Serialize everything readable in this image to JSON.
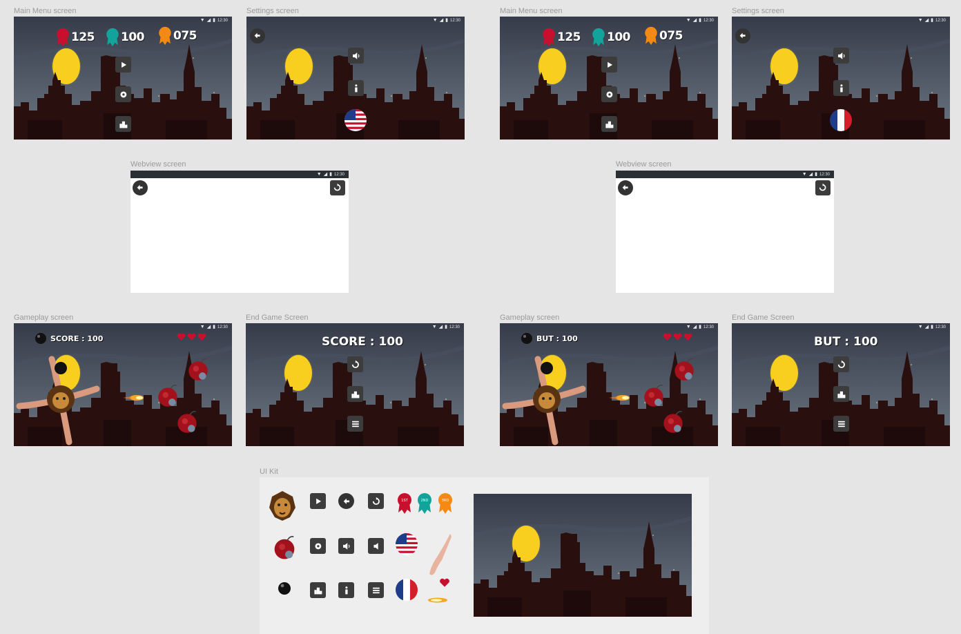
{
  "frames": {
    "main_menu_1": {
      "label": "Main Menu screen",
      "status_time": "12:30",
      "scores": {
        "first": "125",
        "second": "100",
        "third": "075"
      }
    },
    "settings_1": {
      "label": "Settings screen",
      "status_time": "12:30"
    },
    "main_menu_2": {
      "label": "Main Menu screen",
      "status_time": "12:30",
      "scores": {
        "first": "125",
        "second": "100",
        "third": "075"
      }
    },
    "settings_2": {
      "label": "Settings screen",
      "status_time": "12:30"
    },
    "webview_1": {
      "label": "Webview screen",
      "status_time": "12:30"
    },
    "webview_2": {
      "label": "Webview screen",
      "status_time": "12:30"
    },
    "gameplay_1": {
      "label": "Gameplay screen",
      "status_time": "12:30",
      "score_text": "SCORE : 100"
    },
    "endgame_1": {
      "label": "End Game Screen",
      "status_time": "12:30",
      "score_text": "SCORE : 100"
    },
    "gameplay_2": {
      "label": "Gameplay screen",
      "status_time": "12:30",
      "score_text": "BUT : 100"
    },
    "endgame_2": {
      "label": "End Game Screen",
      "status_time": "12:30",
      "score_text": "BUT : 100"
    },
    "ui_kit": {
      "label": "UI Kit"
    }
  },
  "ribbons": {
    "first": "1ST",
    "second": "2ND",
    "third": "3RD"
  },
  "colors": {
    "canvas": "#e5e5e5",
    "sky_top": "#363b49",
    "sky_bottom": "#6d7884",
    "moon": "#f8cf1f",
    "building": "#2a0f0f",
    "button": "#3c3c3c",
    "ribbon_gold": "#c8102e",
    "ribbon_silver": "#12a39a",
    "ribbon_bronze": "#f48a14"
  },
  "icons": [
    "play-icon",
    "gear-icon",
    "podium-icon",
    "back-arrow-icon",
    "sound-icon",
    "info-icon",
    "usa-flag-icon",
    "france-flag-icon",
    "refresh-icon",
    "menu-icon",
    "heart-icon",
    "bomb-icon",
    "cannonball-icon",
    "lion-icon",
    "hand-icon",
    "fireball-icon",
    "ribbon-icon"
  ]
}
